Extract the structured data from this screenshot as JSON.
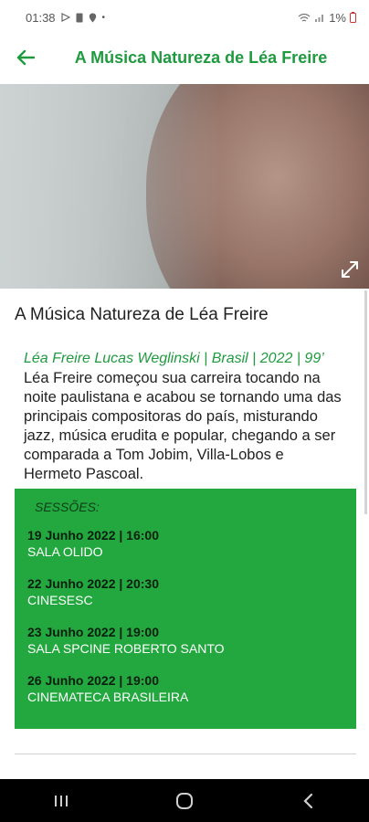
{
  "status_bar": {
    "time": "01:38",
    "battery": "1%"
  },
  "app_bar": {
    "title": "A Música Natureza de Léa Freire"
  },
  "film": {
    "title": "A Música Natureza de Léa Freire",
    "meta": "Léa Freire Lucas Weglinski | Brasil | 2022 | 99’",
    "synopsis": "Léa Freire começou sua carreira tocando na noite paulistana e acabou se tornando uma das principais compositoras do país, misturando jazz, música erudita e popular, chegando a ser comparada a Tom Jobim, Villa-Lobos e Hermeto Pascoal."
  },
  "sessions": {
    "header": "SESSÕES:",
    "items": [
      {
        "date": "19 Junho 2022 | 16:00",
        "venue": "SALA OLIDO"
      },
      {
        "date": "22 Junho 2022 | 20:30",
        "venue": "CINESESC"
      },
      {
        "date": "23 Junho 2022 | 19:00",
        "venue": "SALA SPCINE ROBERTO SANTO"
      },
      {
        "date": "26 Junho 2022 | 19:00",
        "venue": "CINEMATECA BRASILEIRA"
      }
    ]
  },
  "colors": {
    "accent": "#1f9a3f",
    "sessions_bg": "#22a83e"
  }
}
